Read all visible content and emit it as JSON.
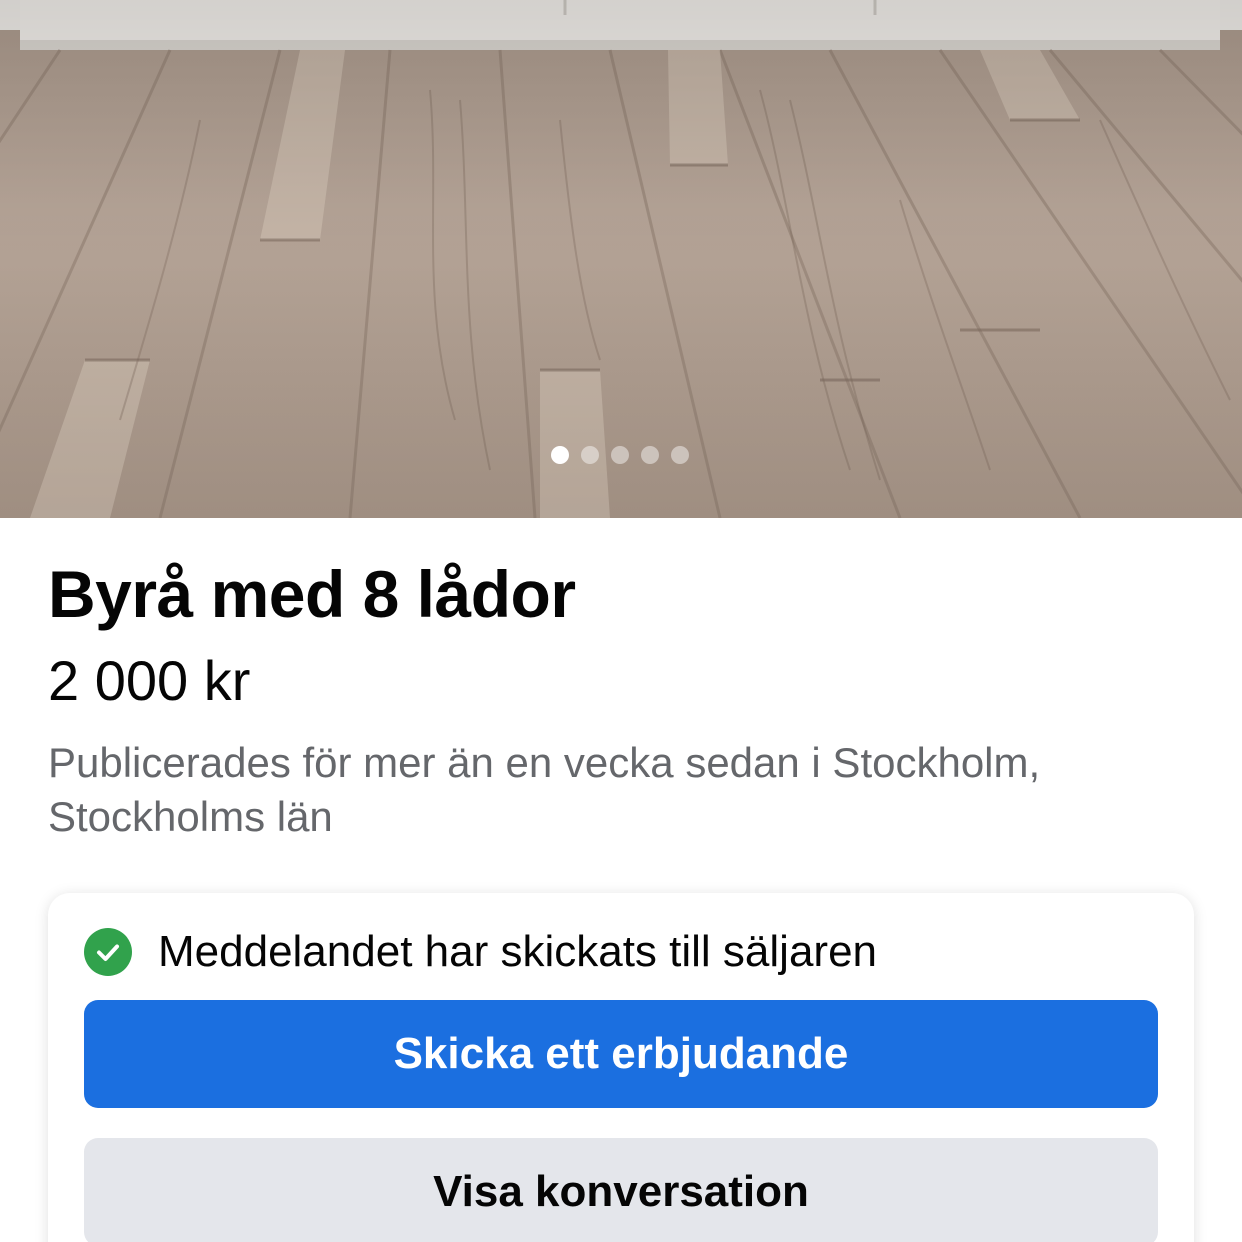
{
  "photo": {
    "subject": "wooden-floor-photo",
    "pager": {
      "count": 5,
      "active_index": 0
    }
  },
  "listing": {
    "title": "Byrå med 8 lådor",
    "price": "2 000 kr",
    "posted": "Publicerades för mer än en vecka sedan i Stockholm, Stockholms län"
  },
  "message_card": {
    "status_icon": "check-circle-icon",
    "status_text": "Meddelandet har skickats till säljaren",
    "primary_button": "Skicka ett erbjudande",
    "secondary_button": "Visa konversation"
  },
  "colors": {
    "primary": "#1b6fe0",
    "success": "#31a24c",
    "secondary_button_bg": "#e4e6eb",
    "muted_text": "#65676b"
  }
}
